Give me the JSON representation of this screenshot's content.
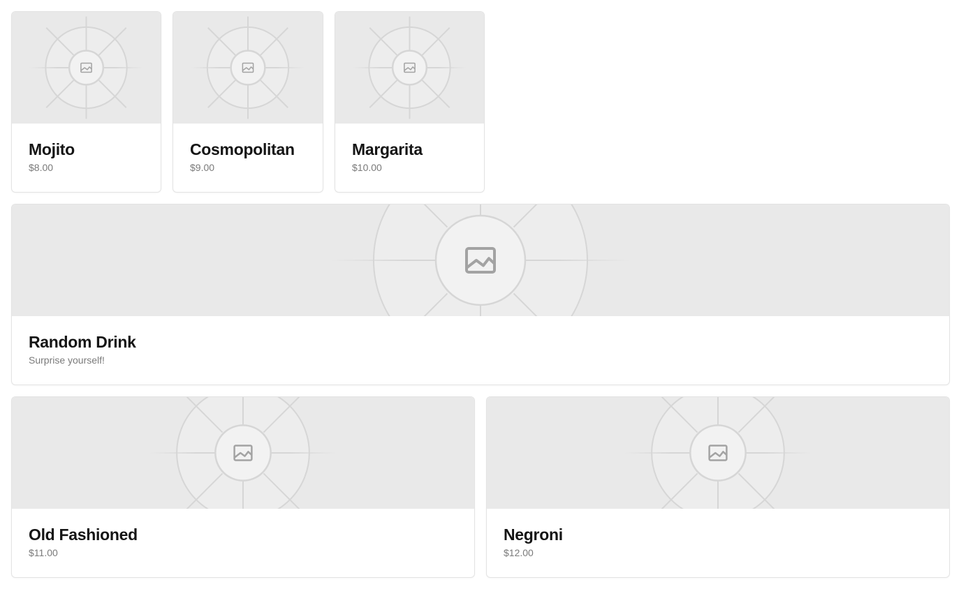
{
  "drinks": [
    {
      "name": "Mojito",
      "price": "$8.00"
    },
    {
      "name": "Cosmopolitan",
      "price": "$9.00"
    },
    {
      "name": "Margarita",
      "price": "$10.00"
    }
  ],
  "random": {
    "name": "Random Drink",
    "subtitle": "Surprise yourself!"
  },
  "featured": [
    {
      "name": "Old Fashioned",
      "price": "$11.00"
    },
    {
      "name": "Negroni",
      "price": "$12.00"
    }
  ],
  "placeholder_icon": "image-placeholder-icon",
  "colors": {
    "image_bg": "#e9e9e9",
    "title": "#151515",
    "subtitle": "#7a7a7a",
    "border": "#e3e3e3"
  }
}
